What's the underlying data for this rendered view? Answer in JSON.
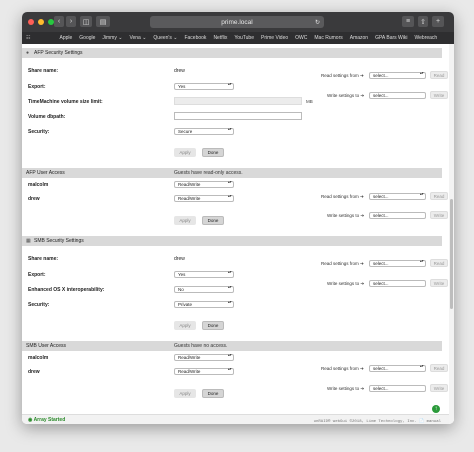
{
  "browser": {
    "address": "prime.local",
    "bookmarks": [
      "Apple",
      "Google",
      "Jimmy ⌄",
      "Vena ⌄",
      "Queen's ⌄",
      "Facebook",
      "Netflix",
      "YouTube",
      "Prime Video",
      "OWC",
      "Mac Rumors",
      "Amazon",
      "GPA Bars Wiki",
      "Webreach"
    ]
  },
  "side": {
    "read_from": "Read settings from ➔",
    "write_to": "Write settings to ➔",
    "select_placeholder": "select...",
    "read_btn": "Read",
    "write_btn": "Write"
  },
  "afp_security": {
    "title": "AFP Security Settings",
    "share_name_label": "Share name:",
    "share_name": "drew",
    "export_label": "Export:",
    "export": "Yes",
    "tm_label": "TimeMachine volume size limit:",
    "tm_unit": "MB",
    "dbpath_label": "Volume dbpath:",
    "security_label": "Security:",
    "security": "Secure",
    "apply": "Apply",
    "done": "Done"
  },
  "afp_access": {
    "title": "AFP User Access",
    "note": "Guests have read-only access.",
    "users": [
      {
        "name": "malcolm",
        "access": "Read/Write"
      },
      {
        "name": "drew",
        "access": "Read/Write"
      }
    ],
    "apply": "Apply",
    "done": "Done"
  },
  "smb_security": {
    "title": "SMB Security Settings",
    "share_name_label": "Share name:",
    "share_name": "drew",
    "export_label": "Export:",
    "export": "Yes",
    "enhanced_label": "Enhanced OS X interoperability:",
    "enhanced": "No",
    "security_label": "Security:",
    "security": "Private",
    "apply": "Apply",
    "done": "Done"
  },
  "smb_access": {
    "title": "SMB User Access",
    "note": "Guests have no access.",
    "users": [
      {
        "name": "malcolm",
        "access": "Read/Write"
      },
      {
        "name": "drew",
        "access": "Read/Write"
      }
    ],
    "apply": "Apply",
    "done": "Done"
  },
  "footer": {
    "status": "◉ Array Started",
    "copyright": "unRAID® webGui ©2018, Lime Technology, Inc. 📄 manual"
  }
}
